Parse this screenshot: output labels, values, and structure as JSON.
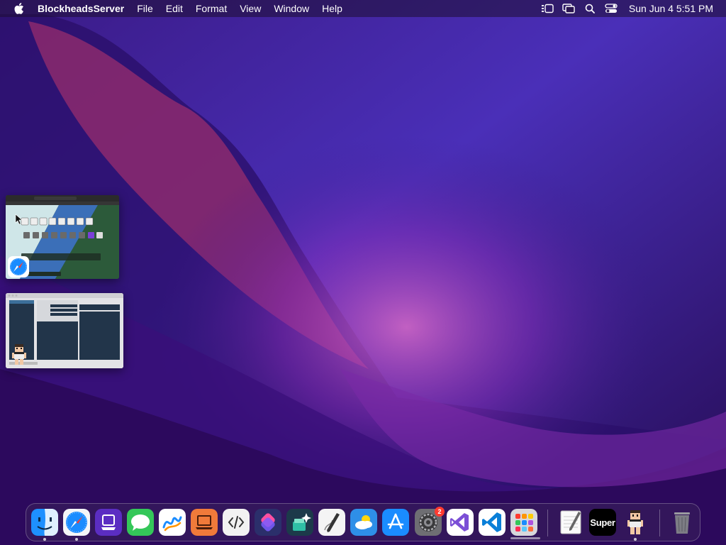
{
  "menubar": {
    "app_name": "BlockheadsServer",
    "menus": [
      "File",
      "Edit",
      "Format",
      "View",
      "Window",
      "Help"
    ],
    "status_icons": [
      "stage-manager-icon",
      "screen-mirroring-icon",
      "spotlight-search-icon",
      "control-center-icon"
    ],
    "datetime": "Sun Jun 4  5:51 PM"
  },
  "previews": [
    {
      "name": "safari-window-preview",
      "app_icon": "safari-icon"
    },
    {
      "name": "blockheads-server-window-preview",
      "app_icon": "blockhead-character-icon"
    }
  ],
  "dock": {
    "apps": [
      {
        "name": "finder",
        "icon": "finder-icon",
        "running": true
      },
      {
        "name": "safari",
        "icon": "safari-icon",
        "running": true
      },
      {
        "name": "podcasts-like",
        "icon": "purple-stack-icon",
        "running": false
      },
      {
        "name": "messages",
        "icon": "messages-icon",
        "running": false
      },
      {
        "name": "freeform",
        "icon": "freeform-icon",
        "running": false
      },
      {
        "name": "keynote-like",
        "icon": "orange-laptop-icon",
        "running": false
      },
      {
        "name": "script-editor",
        "icon": "code-brackets-icon",
        "running": false
      },
      {
        "name": "shortcuts",
        "icon": "shortcuts-icon",
        "running": false
      },
      {
        "name": "utility",
        "icon": "sparkle-box-icon",
        "running": false
      },
      {
        "name": "script-kit",
        "icon": "pen-paper-icon",
        "running": false
      },
      {
        "name": "weather",
        "icon": "weather-icon",
        "running": false
      },
      {
        "name": "app-store",
        "icon": "app-store-icon",
        "running": false
      },
      {
        "name": "system-settings",
        "icon": "gear-icon",
        "running": false,
        "badge": "2"
      },
      {
        "name": "visual-studio",
        "icon": "visual-studio-icon",
        "running": false
      },
      {
        "name": "vscode",
        "icon": "vscode-icon",
        "running": false
      },
      {
        "name": "launchpad",
        "icon": "launchpad-grid-icon",
        "running": false
      },
      {
        "name": "textedit",
        "icon": "textedit-icon",
        "running": false
      },
      {
        "name": "super",
        "icon": "super-icon",
        "label": "Super",
        "running": false
      },
      {
        "name": "blockheads-server",
        "icon": "blockhead-character-icon",
        "running": true
      },
      {
        "name": "trash",
        "icon": "trash-icon",
        "running": false
      }
    ]
  },
  "colors": {
    "accent_safari": "#1a8cff",
    "badge": "#ff3b30",
    "wallpaper_base": "#2a0c5e"
  }
}
